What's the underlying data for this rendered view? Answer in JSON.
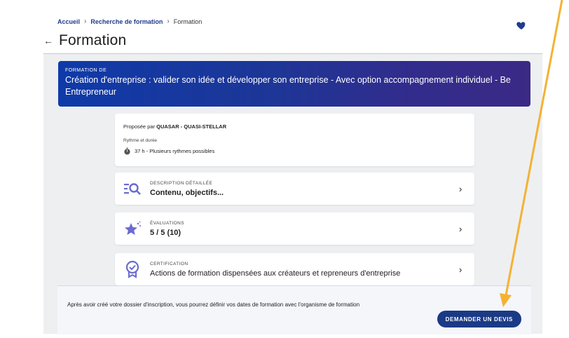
{
  "breadcrumb": {
    "items": [
      "Accueil",
      "Recherche de formation",
      "Formation"
    ]
  },
  "header": {
    "title": "Formation",
    "back_icon": "arrow-left-icon",
    "favorite_icon": "heart-icon",
    "favorite_color": "#1f3c8f"
  },
  "banner": {
    "kicker": "FORMATION DE",
    "title": "Création d'entreprise : valider son idée et développer son entreprise - Avec option accompagnement individuel - Be Entrepreneur"
  },
  "provider": {
    "prefix": "Proposée par",
    "name": "QUASAR - QUASI-STELLAR",
    "rhythm_label": "Rythme et durée",
    "duration": "37 h - Plusieurs rythmes possibles"
  },
  "sections": [
    {
      "kicker": "DESCRIPTION DÉTAILLÉE",
      "value": "Contenu, objectifs...",
      "icon": "search-list-icon"
    },
    {
      "kicker": "ÉVALUATIONS",
      "value": "5 / 5 (10)",
      "icon": "star-icon"
    },
    {
      "kicker": "CERTIFICATION",
      "value": "Actions de formation dispensées aux créateurs et repreneurs d'entreprise",
      "icon": "certificate-icon"
    }
  ],
  "footer": {
    "info": "Après avoir créé votre dossier d'inscription, vous pourrez définir vos dates de formation avec l'organisme de formation",
    "cta": "DEMANDER UN DEVIS"
  },
  "colors": {
    "accent": "#1b3a86",
    "icon": "#6a6bd0",
    "annotation_arrow": "#f4b233"
  }
}
